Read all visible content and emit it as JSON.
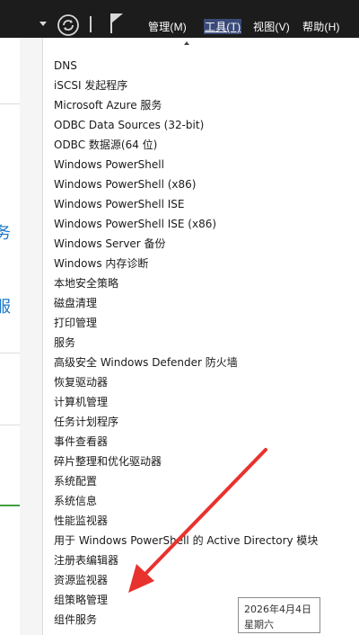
{
  "toolbar": {
    "menus": {
      "manage": "管理(M)",
      "tools": "工具(T)",
      "view": "视图(V)",
      "help": "帮助(H)"
    },
    "icons": [
      "dropdown-arrow-icon",
      "refresh-icon",
      "flag-icon"
    ]
  },
  "background": {
    "text1": "务",
    "text2": "服"
  },
  "tools_menu": {
    "items": [
      "DNS",
      "iSCSI 发起程序",
      "Microsoft Azure 服务",
      "ODBC Data Sources (32-bit)",
      "ODBC 数据源(64 位)",
      "Windows PowerShell",
      "Windows PowerShell (x86)",
      "Windows PowerShell ISE",
      "Windows PowerShell ISE (x86)",
      "Windows Server 备份",
      "Windows 内存诊断",
      "本地安全策略",
      "磁盘清理",
      "打印管理",
      "服务",
      "高级安全 Windows Defender 防火墙",
      "恢复驱动器",
      "计算机管理",
      "任务计划程序",
      "事件查看器",
      "碎片整理和优化驱动器",
      "系统配置",
      "系统信息",
      "性能监视器",
      "用于 Windows PowerShell 的 Active Directory 模块",
      "注册表编辑器",
      "资源监视器",
      "组策略管理",
      "组件服务"
    ]
  },
  "clock_tooltip": {
    "date": "2026年4月4日",
    "weekday": "星期六"
  },
  "colors": {
    "toolbar_bg": "#1c1c1c",
    "annotation_arrow": "#e8322e",
    "link_blue": "#1e78c8"
  }
}
